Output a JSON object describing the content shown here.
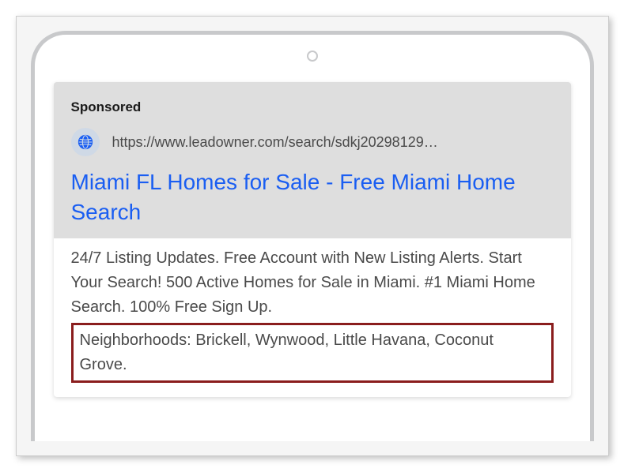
{
  "ad": {
    "sponsored_label": "Sponsored",
    "url": "https://www.leadowner.com/search/sdkj20298129…",
    "title": "Miami FL Homes for Sale - Free Miami Home Search",
    "description": "24/7 Listing Updates. Free Account with New Listing Alerts. Start Your Search! 500 Active Homes for Sale in Miami. #1 Miami Home Search. 100% Free Sign Up.",
    "callout": "Neighborhoods: Brickell, Wynwood, Little Havana, Coconut Grove."
  }
}
